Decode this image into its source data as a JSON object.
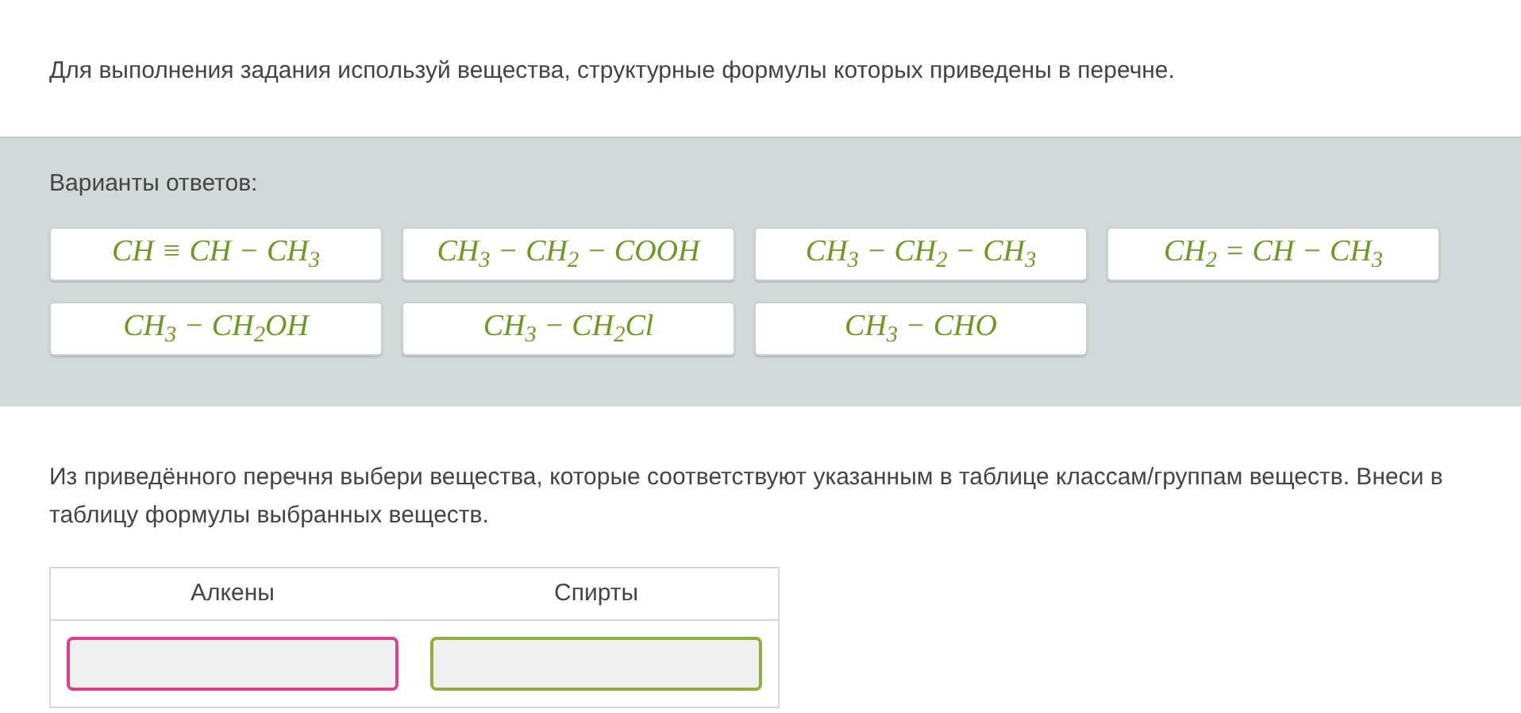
{
  "instruction": "Для выполнения задания используй вещества, структурные формулы которых приведены в перечне.",
  "options": {
    "title": "Варианты ответов:",
    "items": [
      {
        "formula": "CH ≡ CH − CH$_{3}$"
      },
      {
        "formula": "CH$_{3}$ − CH$_{2}$ − COOH"
      },
      {
        "formula": "CH$_{3}$ − CH$_{2}$ − CH$_{3}$"
      },
      {
        "formula": "CH$_{2}$ = CH − CH$_{3}$"
      },
      {
        "formula": "CH$_{3}$ − CH$_{2}$OH"
      },
      {
        "formula": "CH$_{3}$ − CH$_{2}$Cl"
      },
      {
        "formula": "CH$_{3}$ − CHO"
      }
    ]
  },
  "question": "Из приведённого перечня выбери вещества, которые соответствуют указанным в таблице классам/группам веществ. Внеси в таблицу формулы выбранных веществ.",
  "table": {
    "columns": [
      {
        "heading": "Алкены",
        "color": "#d9418f"
      },
      {
        "heading": "Спирты",
        "color": "#8fae3c"
      }
    ]
  }
}
